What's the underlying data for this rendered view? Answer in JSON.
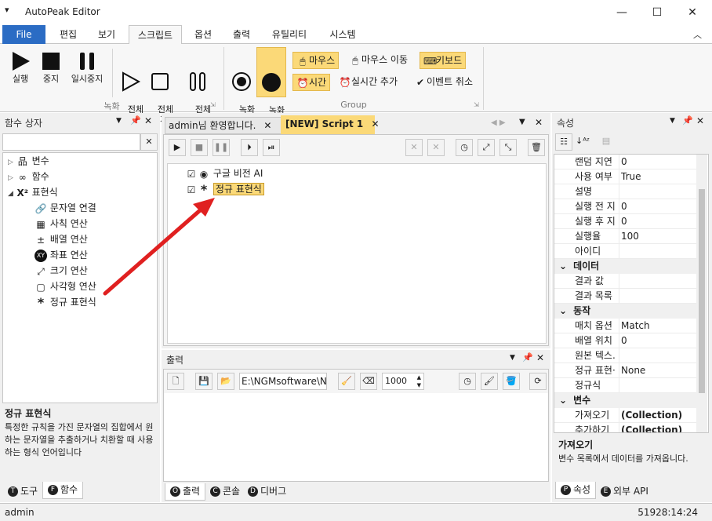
{
  "window": {
    "title": "AutoPeak Editor"
  },
  "ribbon_tabs": [
    {
      "label": "File"
    },
    {
      "label": "편집"
    },
    {
      "label": "보기"
    },
    {
      "label": "스크립트"
    },
    {
      "label": "옵션"
    },
    {
      "label": "출력"
    },
    {
      "label": "유틸리티"
    },
    {
      "label": "시스템"
    }
  ],
  "ribbon": {
    "record_group": {
      "label": "녹화",
      "buttons": [
        {
          "label": "실행"
        },
        {
          "label": "중지"
        },
        {
          "label": "일시중지"
        },
        {
          "label": "전체\n실행"
        },
        {
          "label": "전체\n중지"
        },
        {
          "label": "전체\n일시중지"
        }
      ]
    },
    "group": {
      "label": "Group",
      "record_start": "녹화\n시작",
      "record_stop": "녹화\n중지",
      "mouse": "마우스",
      "mouse_move": "마우스 이동",
      "keyboard": "키보드",
      "time": "시간",
      "realtime_add": "실시간 추가",
      "event_cancel": "이벤트 취소"
    }
  },
  "left_panel": {
    "title": "함수 상자",
    "tree": [
      {
        "label": "변수"
      },
      {
        "label": "함수"
      },
      {
        "label": "표현식"
      },
      {
        "label": "문자열 연결"
      },
      {
        "label": "사칙 연산"
      },
      {
        "label": "배열 연산"
      },
      {
        "label": "좌표 연산"
      },
      {
        "label": "크기 연산"
      },
      {
        "label": "사각형 연산"
      },
      {
        "label": "정규 표현식"
      }
    ],
    "desc_title": "정규 표현식",
    "desc_text": "특정한 규칙을 가진 문자열의 집합에서 원하는 문자열을 추출하거나 치환할 때 사용하는 형식 언어입니다",
    "tabs": [
      {
        "label": "도구",
        "key": "T"
      },
      {
        "label": "함수",
        "key": "F"
      }
    ]
  },
  "editor": {
    "tabs": [
      {
        "label": "admin님 환영합니다."
      },
      {
        "label": "[NEW] Script 1"
      }
    ],
    "items": [
      {
        "label": "구글 비전 AI"
      },
      {
        "label": "정규 표현식"
      }
    ]
  },
  "output": {
    "title": "출력",
    "path": "E:\\NGMsoftware\\NG",
    "count": "1000",
    "tabs": [
      {
        "label": "출력",
        "key": "O"
      },
      {
        "label": "콘솔",
        "key": "C"
      },
      {
        "label": "디버그",
        "key": "D"
      }
    ]
  },
  "properties": {
    "title": "속성",
    "rows": [
      {
        "type": "prop",
        "name": "랜덤 지연",
        "value": "0"
      },
      {
        "type": "prop",
        "name": "사용 여부",
        "value": "True"
      },
      {
        "type": "prop",
        "name": "설명",
        "value": ""
      },
      {
        "type": "prop",
        "name": "실행 전 지",
        "value": "0"
      },
      {
        "type": "prop",
        "name": "실행 후 지",
        "value": "0"
      },
      {
        "type": "prop",
        "name": "실행율",
        "value": "100"
      },
      {
        "type": "prop",
        "name": "아이디",
        "value": ""
      },
      {
        "type": "cat",
        "name": "데이터"
      },
      {
        "type": "prop",
        "name": "결과 값",
        "value": ""
      },
      {
        "type": "prop",
        "name": "결과 목록",
        "value": ""
      },
      {
        "type": "cat",
        "name": "동작"
      },
      {
        "type": "prop",
        "name": "매치 옵션",
        "value": "Match"
      },
      {
        "type": "prop",
        "name": "배열 위치",
        "value": "0"
      },
      {
        "type": "prop",
        "name": "원본 텍스.",
        "value": ""
      },
      {
        "type": "prop",
        "name": "정규 표현·",
        "value": "None"
      },
      {
        "type": "prop",
        "name": "정규식",
        "value": ""
      },
      {
        "type": "cat",
        "name": "변수"
      },
      {
        "type": "prop",
        "name": "가져오기",
        "value": "(Collection)",
        "bold": true
      },
      {
        "type": "prop",
        "name": "추가하기",
        "value": "(Collection)",
        "bold": true
      }
    ],
    "desc_title": "가져오기",
    "desc_text": "변수 목록에서 데이터를 가져옵니다.",
    "tabs": [
      {
        "label": "속성",
        "key": "P"
      },
      {
        "label": "외부 API",
        "key": "E"
      }
    ]
  },
  "status": {
    "user": "admin",
    "time": "51928:14:24"
  },
  "colors": {
    "file_tab": "#2b6cc4",
    "highlight": "#fbd978",
    "arrow": "#e02020"
  }
}
